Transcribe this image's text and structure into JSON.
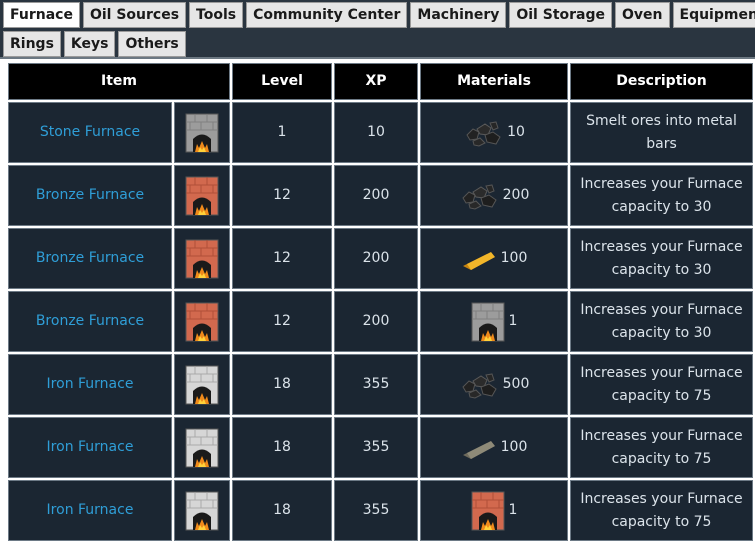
{
  "tabs": {
    "row1": [
      "Furnace",
      "Oil Sources",
      "Tools",
      "Community Center",
      "Machinery",
      "Oil Storage",
      "Oven",
      "Equipments"
    ],
    "row2": [
      "Rings",
      "Keys",
      "Others"
    ],
    "active": "Furnace"
  },
  "table": {
    "headers": {
      "item": "Item",
      "level": "Level",
      "xp": "XP",
      "materials": "Materials",
      "description": "Description"
    },
    "rows": [
      {
        "name": "Stone Furnace",
        "icon": "stone-furnace-icon",
        "level": "1",
        "xp": "10",
        "material_icon": "coal-icon",
        "material_qty": "10",
        "description_line1": "Smelt ores into metal",
        "description_line2": "bars"
      },
      {
        "name": "Bronze Furnace",
        "icon": "bronze-furnace-icon",
        "level": "12",
        "xp": "200",
        "material_icon": "coal-icon",
        "material_qty": "200",
        "description_line1": "Increases your Furnace",
        "description_line2": "capacity to 30"
      },
      {
        "name": "Bronze Furnace",
        "icon": "bronze-furnace-icon",
        "level": "12",
        "xp": "200",
        "material_icon": "gold-bar-icon",
        "material_qty": "100",
        "description_line1": "Increases your Furnace",
        "description_line2": "capacity to 30"
      },
      {
        "name": "Bronze Furnace",
        "icon": "bronze-furnace-icon",
        "level": "12",
        "xp": "200",
        "material_icon": "stone-furnace-icon",
        "material_qty": "1",
        "description_line1": "Increases your Furnace",
        "description_line2": "capacity to 30"
      },
      {
        "name": "Iron Furnace",
        "icon": "iron-furnace-icon",
        "level": "18",
        "xp": "355",
        "material_icon": "coal-icon",
        "material_qty": "500",
        "description_line1": "Increases your Furnace",
        "description_line2": "capacity to 75"
      },
      {
        "name": "Iron Furnace",
        "icon": "iron-furnace-icon",
        "level": "18",
        "xp": "355",
        "material_icon": "iron-bar-icon",
        "material_qty": "100",
        "description_line1": "Increases your Furnace",
        "description_line2": "capacity to 75"
      },
      {
        "name": "Iron Furnace",
        "icon": "iron-furnace-icon",
        "level": "18",
        "xp": "355",
        "material_icon": "bronze-furnace-icon",
        "material_qty": "1",
        "description_line1": "Increases your Furnace",
        "description_line2": "capacity to 75"
      }
    ]
  },
  "colors": {
    "page_background": "#2a3540",
    "cell_background": "#1b2632",
    "header_background": "#000000",
    "link_color": "#2f9ed7",
    "stone": "#9c9c9c",
    "bronze": "#d2694e",
    "iron": "#d6d6d6",
    "gold": "#e8a81e"
  }
}
